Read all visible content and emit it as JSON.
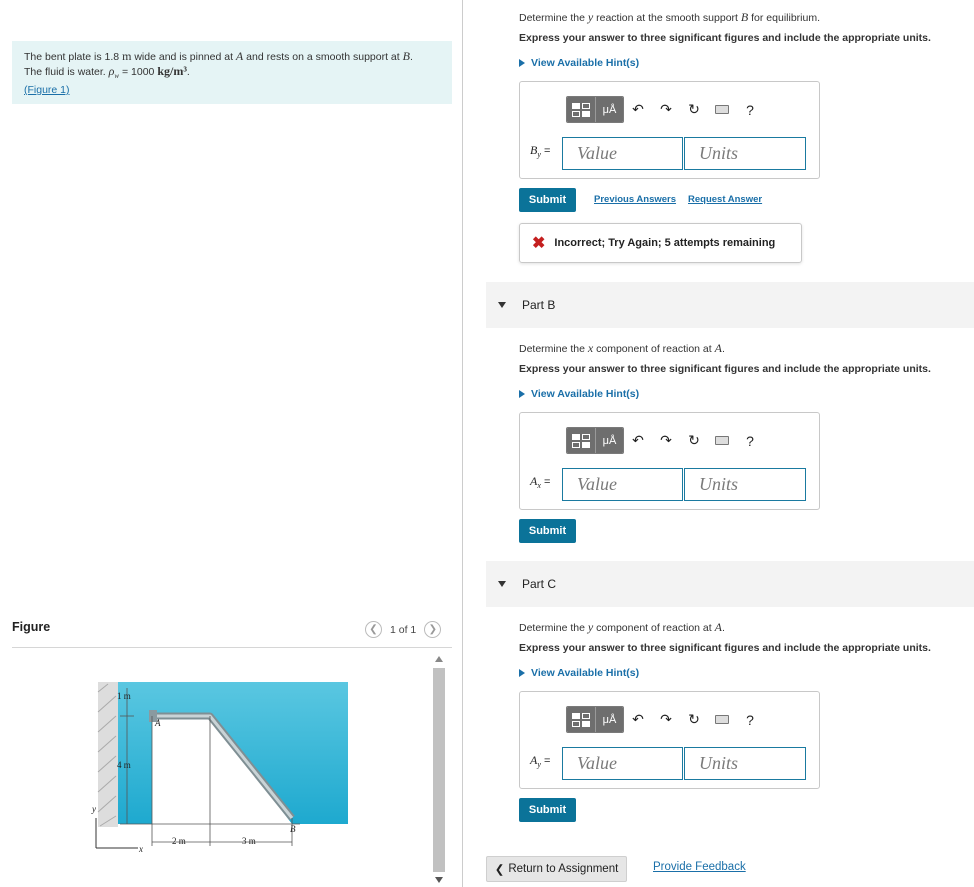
{
  "problem": {
    "text1": "The bent plate is 1.8 ",
    "unit_m": "m",
    "text2": " wide and is pinned at ",
    "var_a": "A",
    "text3": " and rests on a smooth support at ",
    "var_b": "B",
    "text4": ".",
    "text5": "The fluid is water. ",
    "rho": "ρ",
    "rho_sub": "w",
    "text6": " = 1000 ",
    "density_unit": "kg/m³",
    "text7": ".",
    "figure_link": "(Figure 1)"
  },
  "figure": {
    "title": "Figure",
    "pager_text": "1 of 1",
    "labels": {
      "one_m": "1 m",
      "four_m": "4 m",
      "two_m": "2 m",
      "three_m": "3 m",
      "point_a": "A",
      "point_b": "B",
      "axis_x": "x",
      "axis_y": "y"
    }
  },
  "part_a": {
    "prompt_pre": "Determine the ",
    "prompt_var": "y",
    "prompt_post": " reaction at the smooth support ",
    "prompt_var2": "B",
    "prompt_end": " for equilibrium.",
    "instructions": "Express your answer to three significant figures and include the appropriate units.",
    "hint_label": "View Available Hint(s)",
    "answer_label": "B",
    "answer_sub": "y",
    "answer_eq": " =",
    "value_placeholder": "Value",
    "units_placeholder": "Units",
    "submit_label": "Submit",
    "prev_answers_label": "Previous Answers",
    "request_answer_label": "Request Answer",
    "feedback": "Incorrect; Try Again; 5 attempts remaining"
  },
  "part_b": {
    "band_label": "Part B",
    "prompt_pre": "Determine the ",
    "prompt_var": "x",
    "prompt_post": " component of reaction at ",
    "prompt_var2": "A",
    "prompt_end": ".",
    "instructions": "Express your answer to three significant figures and include the appropriate units.",
    "hint_label": "View Available Hint(s)",
    "answer_label": "A",
    "answer_sub": "x",
    "answer_eq": " =",
    "value_placeholder": "Value",
    "units_placeholder": "Units",
    "submit_label": "Submit"
  },
  "part_c": {
    "band_label": "Part C",
    "prompt_pre": "Determine the ",
    "prompt_var": "y",
    "prompt_post": " component of reaction at ",
    "prompt_var2": "A",
    "prompt_end": ".",
    "instructions": "Express your answer to three significant figures and include the appropriate units.",
    "hint_label": "View Available Hint(s)",
    "answer_label": "A",
    "answer_sub": "y",
    "answer_eq": " =",
    "value_placeholder": "Value",
    "units_placeholder": "Units",
    "submit_label": "Submit"
  },
  "toolbar": {
    "mu_label": "μÅ",
    "help_label": "?",
    "icons": [
      "templates-icon",
      "mu-angstrom-icon",
      "undo-icon",
      "redo-icon",
      "reset-icon",
      "keyboard-icon",
      "help-icon"
    ]
  },
  "footer": {
    "return_label": "Return to Assignment",
    "feedback_label": "Provide Feedback"
  },
  "colors": {
    "water": "#33bcd9",
    "accent": "#0b7399",
    "link": "#1a6fa8",
    "error": "#c41f1f",
    "problem_bg": "#e5f4f5"
  }
}
